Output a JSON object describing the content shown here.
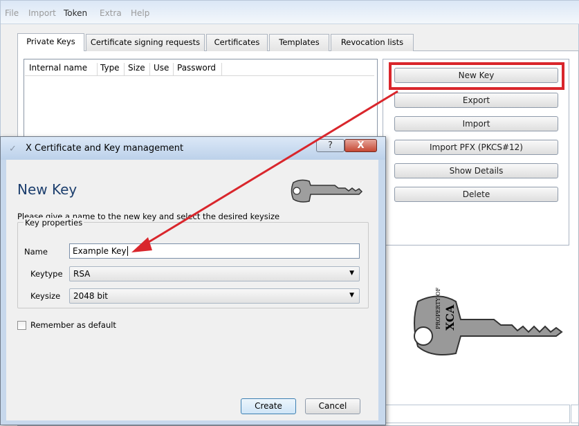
{
  "menu": {
    "file": "File",
    "import": "Import",
    "token": "Token",
    "extra": "Extra",
    "help": "Help"
  },
  "tabs": [
    {
      "label": "Private Keys"
    },
    {
      "label": "Certificate signing requests"
    },
    {
      "label": "Certificates"
    },
    {
      "label": "Templates"
    },
    {
      "label": "Revocation lists"
    }
  ],
  "table": {
    "columns": [
      "Internal name",
      "Type",
      "Size",
      "Use",
      "Password"
    ]
  },
  "buttons": {
    "new_key": "New Key",
    "export": "Export",
    "import": "Import",
    "import_pfx": "Import PFX (PKCS#12)",
    "show_details": "Show Details",
    "delete": "Delete"
  },
  "dialog": {
    "window_title": "X Certificate and Key management",
    "help": "?",
    "close": "X",
    "heading": "New Key",
    "description": "Please give a name to the new key and select the desired keysize",
    "group_title": "Key properties",
    "name_label": "Name",
    "name_value": "Example Key",
    "keytype_label": "Keytype",
    "keytype_value": "RSA",
    "keysize_label": "Keysize",
    "keysize_value": "2048 bit",
    "remember_label": "Remember as default",
    "create": "Create",
    "cancel": "Cancel"
  },
  "key_logo": {
    "line1": "PROPERTY OF",
    "line2": "XCA"
  },
  "colors": {
    "accent_red": "#d9262c",
    "heading_blue": "#1d3f6e"
  }
}
